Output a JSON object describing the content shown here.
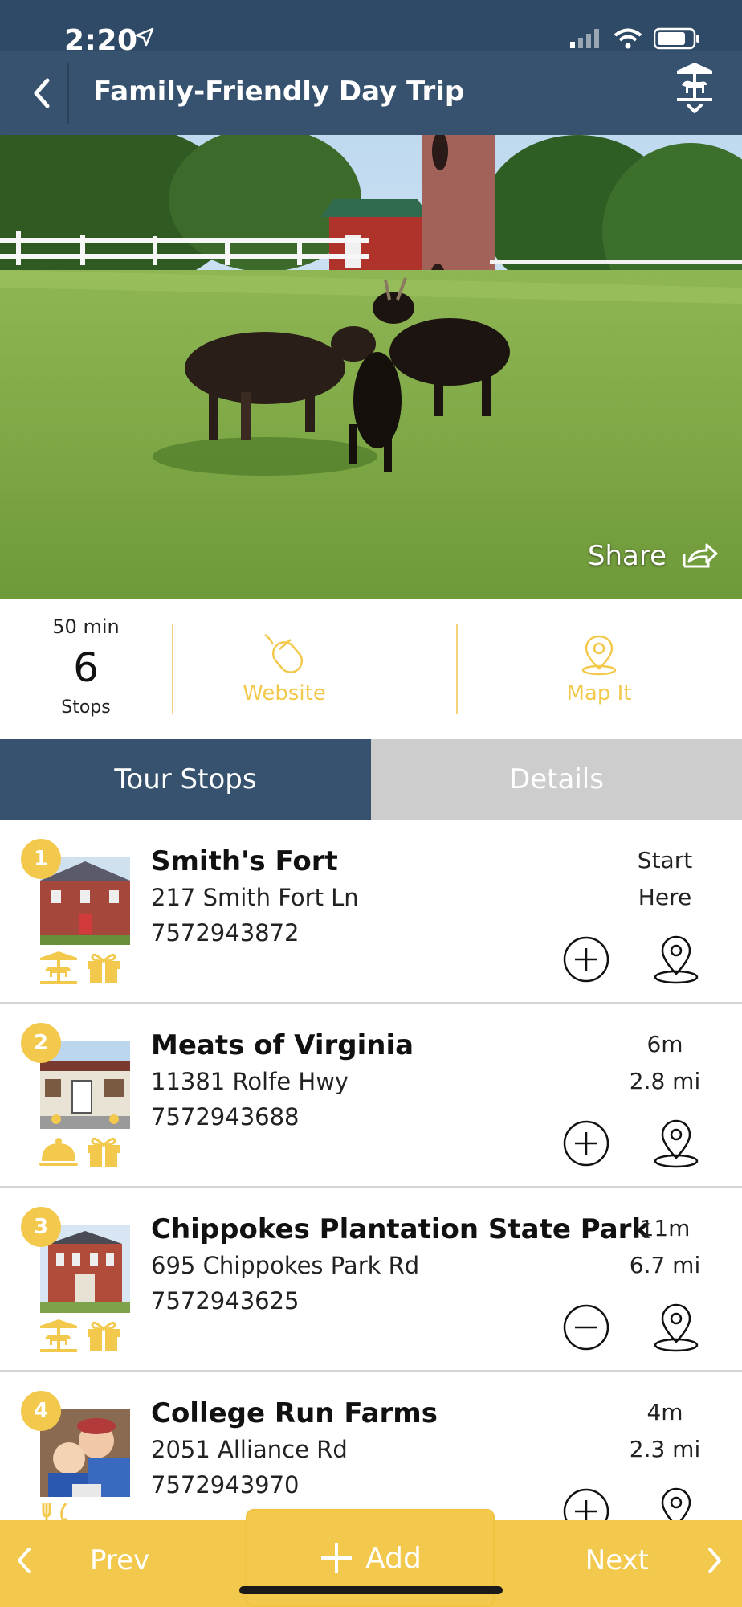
{
  "status": {
    "time": "2:20"
  },
  "nav": {
    "title": "Family-Friendly Day Trip"
  },
  "hero": {
    "share_label": "Share"
  },
  "stats": {
    "duration": "50 min",
    "stop_count": "6",
    "stop_label": "Stops",
    "website_label": "Website",
    "map_label": "Map It"
  },
  "tabs": [
    {
      "label": "Tour Stops",
      "active": true
    },
    {
      "label": "Details",
      "active": false
    }
  ],
  "stops": [
    {
      "number": "1",
      "name": "Smith's Fort",
      "address": "217 Smith Fort Ln",
      "phone": "7572943872",
      "meta1": "Start",
      "meta2": "Here",
      "in_trip": false
    },
    {
      "number": "2",
      "name": "Meats of Virginia",
      "address": "11381 Rolfe Hwy",
      "phone": "7572943688",
      "meta1": "6m",
      "meta2": "2.8 mi",
      "in_trip": false
    },
    {
      "number": "3",
      "name": "Chippokes Plantation State Park",
      "address": "695 Chippokes Park Rd",
      "phone": "7572943625",
      "meta1": "11m",
      "meta2": "6.7 mi",
      "in_trip": true
    },
    {
      "number": "4",
      "name": "College Run Farms",
      "address": "2051 Alliance Rd",
      "phone": "7572943970",
      "meta1": "4m",
      "meta2": "2.3 mi",
      "in_trip": false
    }
  ],
  "bottom": {
    "prev_label": "Prev",
    "add_label": "Add",
    "next_label": "Next"
  },
  "colors": {
    "navy": "#36526f",
    "accent": "#f2c94c",
    "tab_inactive": "#cdcdcd"
  }
}
